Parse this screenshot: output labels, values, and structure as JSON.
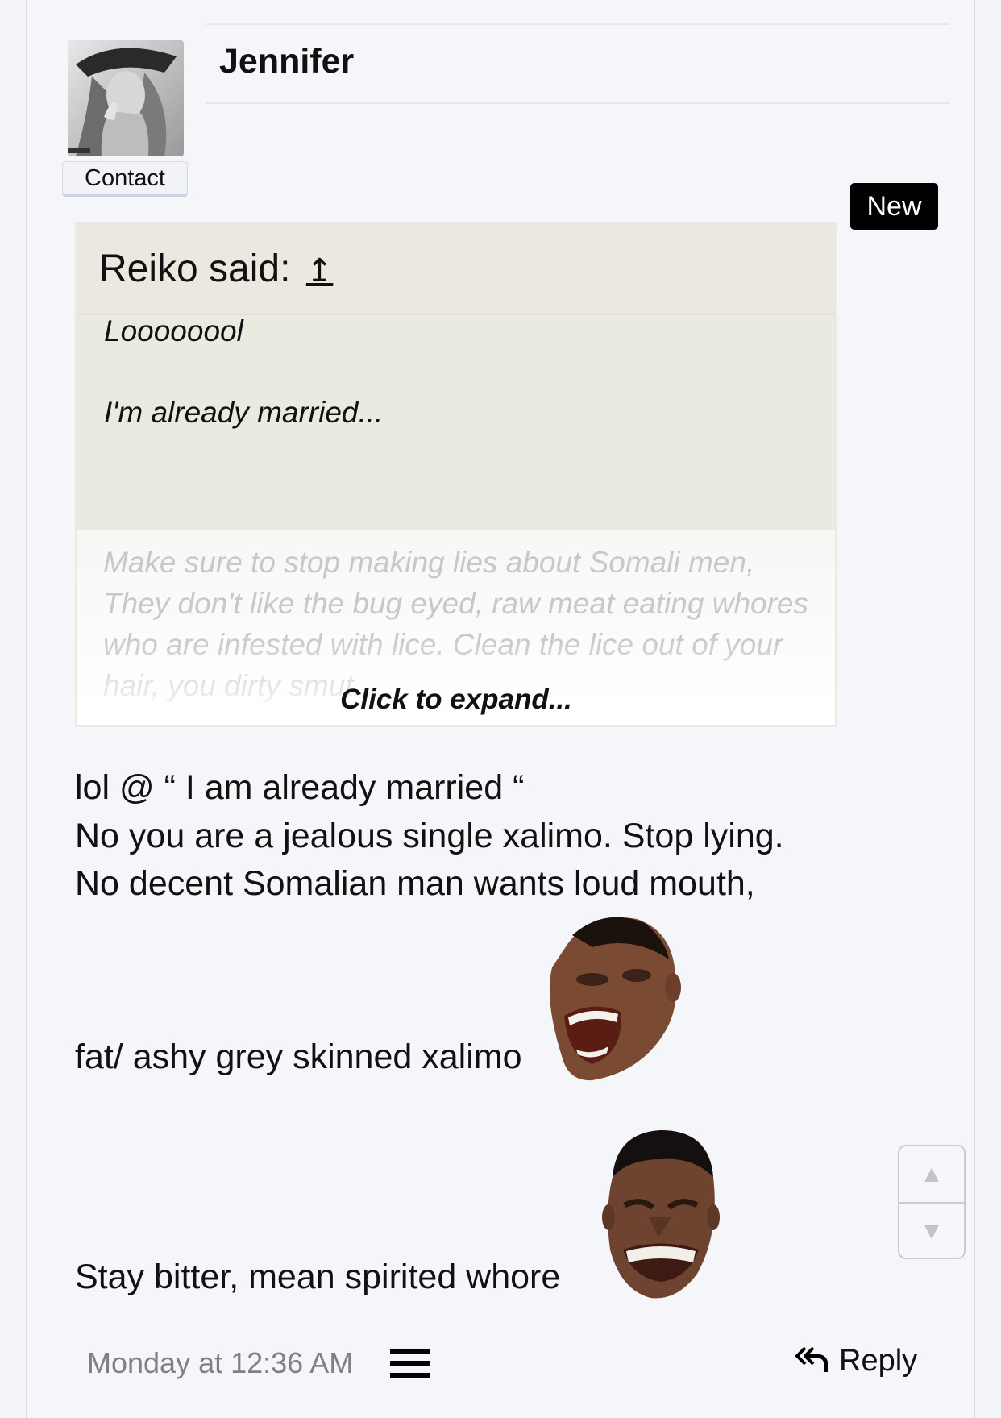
{
  "post": {
    "author": "Jennifer",
    "contact_label": "Contact",
    "new_badge": "New",
    "quote": {
      "author_label": "Reiko said:",
      "jump_icon": "↥",
      "lines": [
        "Loooooool",
        "I'm already married..."
      ],
      "hidden_text": "Make sure to stop making lies about Somali men, They don't like the bug eyed, raw meat eating whores who are infested with lice. Clean the lice out of your hair, you dirty smut...",
      "expand_label": "Click to expand..."
    },
    "message": {
      "line1": "lol @ “ I am already married “",
      "line2": "No you are a jealous single xalimo. Stop lying.",
      "line3": "No decent Somalian man wants loud mouth,",
      "line4": "fat/ ashy grey skinned xalimo",
      "line5": "Stay bitter, mean spirited whore"
    },
    "footer": {
      "timestamp": "Monday at 12:36 AM",
      "reply_label": "Reply"
    },
    "nav": {
      "up_icon": "▲",
      "down_icon": "▼"
    }
  },
  "icons": {
    "menu": "hamburger-icon",
    "reply": "reply-all-icon"
  }
}
